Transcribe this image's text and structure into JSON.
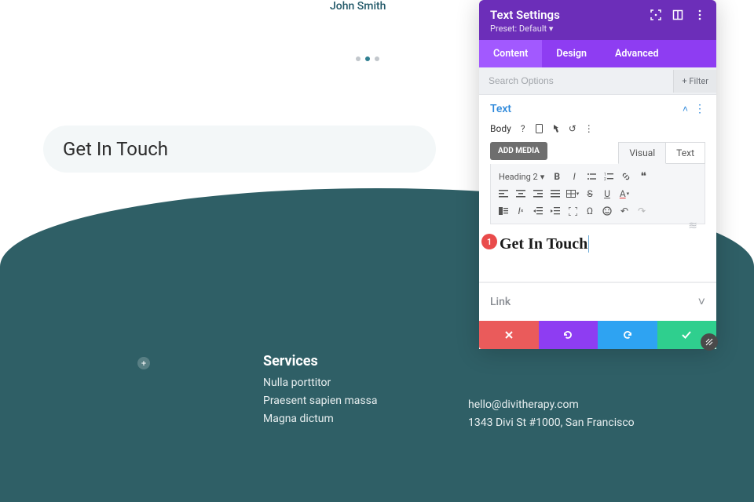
{
  "bg": {
    "author": "John Smith",
    "hero": "Get In Touch",
    "services_heading": "Services",
    "services": [
      "Nulla porttitor",
      "Praesent sapien massa",
      "Magna dictum"
    ],
    "contact_email": "hello@divitherapy.com",
    "contact_addr": "1343 Divi St #1000, San Francisco"
  },
  "panel": {
    "title": "Text Settings",
    "preset": "Preset: Default ▾",
    "tabs": [
      "Content",
      "Design",
      "Advanced"
    ],
    "search_placeholder": "Search Options",
    "filter_label": "Filter",
    "text_section": "Text",
    "body_label": "Body",
    "add_media": "ADD MEDIA",
    "editor_tabs": [
      "Visual",
      "Text"
    ],
    "format_select": "Heading 2",
    "editor_content": "Get In Touch",
    "badge": "1",
    "link_section": "Link"
  }
}
